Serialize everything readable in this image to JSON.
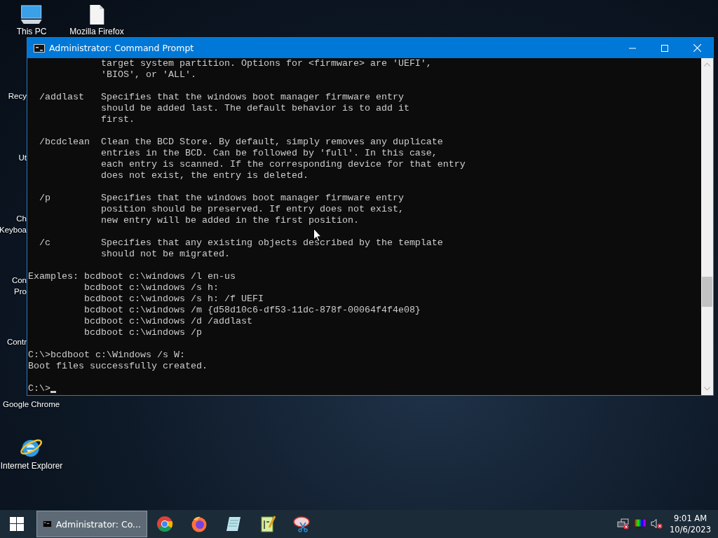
{
  "desktop_icons": [
    {
      "kind": "pc",
      "lines": [
        "This PC"
      ]
    },
    {
      "kind": "file",
      "lines": [
        "Mozilla Firefox"
      ]
    },
    {
      "kind": "hidden",
      "lines": [
        "Recy"
      ]
    },
    {
      "kind": "hidden",
      "lines": [
        "Ut"
      ]
    },
    {
      "kind": "hidden",
      "lines": [
        "Ch",
        "Keyboa"
      ]
    },
    {
      "kind": "hidden",
      "lines": [
        "Con",
        "Pro"
      ]
    },
    {
      "kind": "hidden",
      "lines": [
        "Contr"
      ]
    },
    {
      "kind": "hidden",
      "lines": [
        "Google Chrome"
      ]
    },
    {
      "kind": "ie",
      "lines": [
        "Internet Explorer"
      ]
    }
  ],
  "window": {
    "title": "Administrator: Command Prompt",
    "console_blocks": [
      [
        "             target system partition. Options for <firmware> are 'UEFI',",
        "             'BIOS', or 'ALL'."
      ],
      [
        "  /addlast   Specifies that the windows boot manager firmware entry",
        "             should be added last. The default behavior is to add it",
        "             first."
      ],
      [
        "  /bcdclean  Clean the BCD Store. By default, simply removes any duplicate",
        "             entries in the BCD. Can be followed by 'full'. In this case,",
        "             each entry is scanned. If the corresponding device for that entry",
        "             does not exist, the entry is deleted."
      ],
      [
        "  /p         Specifies that the windows boot manager firmware entry",
        "             position should be preserved. If entry does not exist,",
        "             new entry will be added in the first position."
      ],
      [
        "  /c         Specifies that any existing objects described by the template",
        "             should not be migrated."
      ],
      [
        "Examples: bcdboot c:\\windows /l en-us",
        "          bcdboot c:\\windows /s h:",
        "          bcdboot c:\\windows /s h: /f UEFI",
        "          bcdboot c:\\windows /m {d58d10c6-df53-11dc-878f-00064f4f4e08}",
        "          bcdboot c:\\windows /d /addlast",
        "          bcdboot c:\\windows /p"
      ],
      [
        "C:\\>bcdboot c:\\Windows /s W:",
        "Boot files successfully created."
      ],
      [
        "C:\\>"
      ]
    ]
  },
  "taskbar": {
    "tasks": [
      {
        "title": "Administrator: Co...",
        "selected": true
      }
    ],
    "pinned": [
      {
        "kind": "chrome"
      },
      {
        "kind": "firefox"
      },
      {
        "kind": "notepad"
      },
      {
        "kind": "notepadpp"
      },
      {
        "kind": "snip"
      }
    ],
    "tray": {
      "time": "9:01 AM",
      "date": "10/6/2023"
    }
  }
}
